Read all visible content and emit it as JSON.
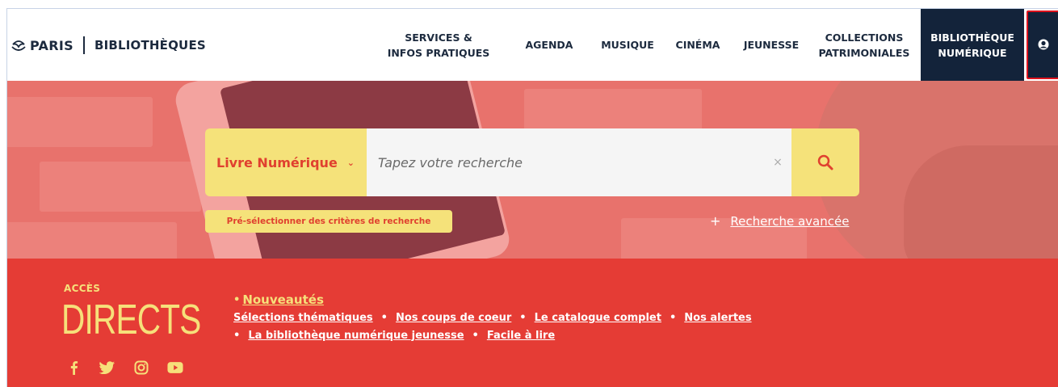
{
  "header": {
    "logo_paris": "PARIS",
    "logo_biblio": "BIBLIOTHÈQUES",
    "nav": [
      {
        "line1": "SERVICES &",
        "line2": "INFOS PRATIQUES"
      },
      {
        "line1": "AGENDA",
        "line2": ""
      },
      {
        "line1": "MUSIQUE",
        "line2": ""
      },
      {
        "line1": "CINÉMA",
        "line2": ""
      },
      {
        "line1": "JEUNESSE",
        "line2": ""
      },
      {
        "line1": "COLLECTIONS",
        "line2": "PATRIMONIALES"
      },
      {
        "line1": "BIBLIOTHÈQUE",
        "line2": "NUMÉRIQUE"
      }
    ],
    "account_icon": "user-icon"
  },
  "search": {
    "type_label": "Livre Numérique",
    "placeholder": "Tapez votre recherche",
    "clear": "×",
    "preselect": "Pré-sélectionner des critères de recherche",
    "advanced_plus": "+",
    "advanced": "Recherche avancée"
  },
  "access": {
    "small": "ACCÈS",
    "big": "DIRECTS",
    "links": {
      "nouveautes": "Nouveautés",
      "selections": "Sélections thématiques",
      "coups": "Nos coups de coeur",
      "catalogue": "Le catalogue complet",
      "alertes": "Nos alertes",
      "jeunesse": "La bibliothèque numérique jeunesse",
      "facile": "Facile à lire"
    },
    "dot": "•",
    "socials": [
      "facebook-icon",
      "twitter-icon",
      "instagram-icon",
      "youtube-icon"
    ]
  },
  "colors": {
    "navy": "#13233a",
    "red": "#e53c35",
    "yellow": "#f5e27a",
    "hero": "#e8726c"
  }
}
